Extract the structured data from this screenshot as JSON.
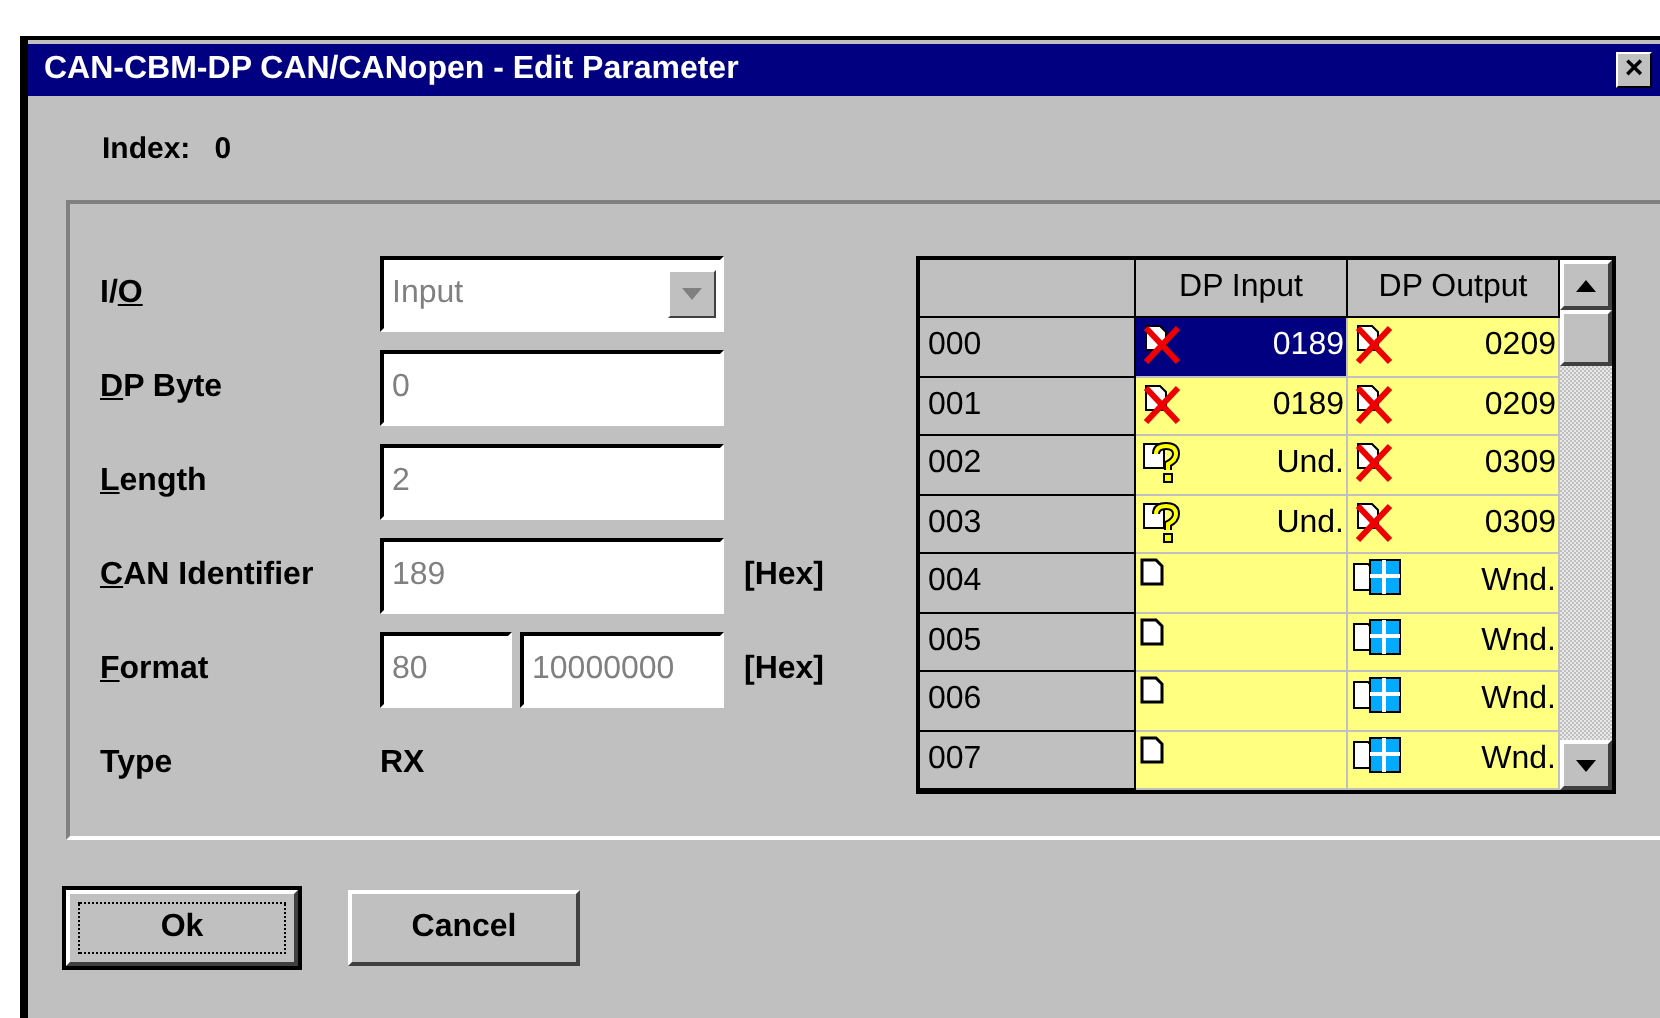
{
  "window": {
    "title": "CAN-CBM-DP CAN/CANopen - Edit Parameter",
    "close": "×"
  },
  "index": {
    "label": "Index:",
    "value": "0"
  },
  "fields": [
    {
      "kind": "dropdown",
      "label": {
        "pre": "I/",
        "key": "O"
      },
      "value": "Input",
      "disabled": true
    },
    {
      "kind": "text",
      "label": {
        "key": "D",
        "post": "P Byte"
      },
      "value": "0",
      "disabled": true
    },
    {
      "kind": "text",
      "label": {
        "key": "L",
        "post": "ength"
      },
      "value": "2",
      "disabled": true
    },
    {
      "kind": "text",
      "label": {
        "key": "C",
        "post": "AN Identifier"
      },
      "value": "189",
      "unit": "[Hex]",
      "disabled": true
    },
    {
      "kind": "pair",
      "label": {
        "key": "F",
        "post": "ormat"
      },
      "value": "80",
      "value2": "10000000",
      "unit": "[Hex]",
      "disabled": true
    },
    {
      "kind": "static",
      "label": {
        "post": "Type"
      },
      "value": "RX"
    }
  ],
  "table": {
    "columns": [
      "DP Input",
      "DP Output"
    ],
    "rows": [
      {
        "label": "000",
        "cells": [
          {
            "kind": "error",
            "text": "0189",
            "selected": true
          },
          {
            "kind": "error",
            "text": "0209",
            "selected": false
          }
        ]
      },
      {
        "label": "001",
        "cells": [
          {
            "kind": "error",
            "text": "0189",
            "selected": false
          },
          {
            "kind": "error",
            "text": "0209",
            "selected": false
          }
        ]
      },
      {
        "label": "002",
        "cells": [
          {
            "kind": "unknown",
            "text": "Und.",
            "selected": false
          },
          {
            "kind": "error",
            "text": "0309",
            "selected": false
          }
        ]
      },
      {
        "label": "003",
        "cells": [
          {
            "kind": "unknown",
            "text": "Und.",
            "selected": false
          },
          {
            "kind": "error",
            "text": "0309",
            "selected": false
          }
        ]
      },
      {
        "label": "004",
        "cells": [
          {
            "kind": "empty",
            "selected": false
          },
          {
            "kind": "window",
            "text": "Wnd.",
            "selected": false
          }
        ]
      },
      {
        "label": "005",
        "cells": [
          {
            "kind": "empty",
            "selected": false
          },
          {
            "kind": "window",
            "text": "Wnd.",
            "selected": false
          }
        ]
      },
      {
        "label": "006",
        "cells": [
          {
            "kind": "empty",
            "selected": false
          },
          {
            "kind": "window",
            "text": "Wnd.",
            "selected": false
          }
        ]
      },
      {
        "label": "007",
        "cells": [
          {
            "kind": "empty",
            "selected": false
          },
          {
            "kind": "window",
            "text": "Wnd.",
            "selected": false
          }
        ]
      }
    ]
  },
  "buttons": [
    {
      "label": "Ok",
      "default": true
    },
    {
      "label": "Cancel",
      "default": false
    }
  ]
}
